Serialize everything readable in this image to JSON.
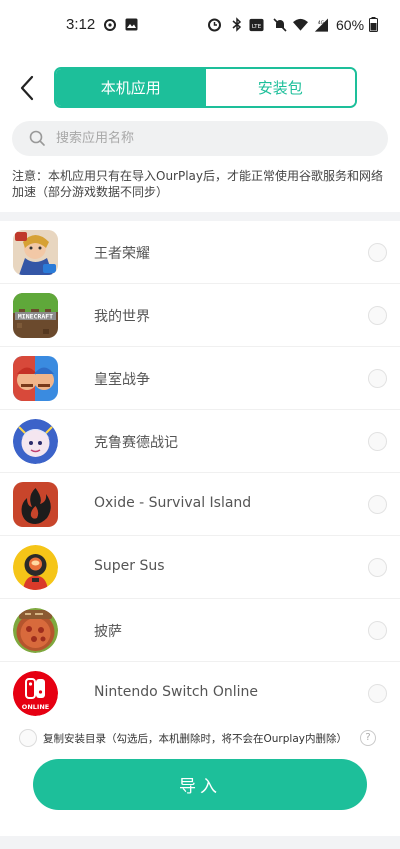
{
  "status_bar": {
    "time": "3:12",
    "battery": "60%",
    "icons": [
      "refresh-icon",
      "image-icon",
      "alarm-icon",
      "bluetooth-icon",
      "volte-icon",
      "mute-icon",
      "wifi-icon",
      "signal-4g-icon",
      "battery-icon"
    ]
  },
  "header": {
    "tabs": [
      {
        "label": "本机应用",
        "active": true
      },
      {
        "label": "安装包",
        "active": false
      }
    ]
  },
  "search": {
    "placeholder": "搜索应用名称",
    "value": ""
  },
  "notice": "注意：本机应用只有在导入OurPlay后，才能正常使用谷歌服务和网络加速（部分游戏数据不同步）",
  "apps": [
    {
      "name": "王者荣耀",
      "icon": "honor-of-kings-icon",
      "selected": false
    },
    {
      "name": "我的世界",
      "icon": "minecraft-icon",
      "selected": false
    },
    {
      "name": "皇室战争",
      "icon": "clash-royale-icon",
      "selected": false
    },
    {
      "name": "克鲁赛德战记",
      "icon": "crusaders-quest-icon",
      "selected": false
    },
    {
      "name": "Oxide - Survival Island",
      "icon": "oxide-icon",
      "selected": false
    },
    {
      "name": "Super Sus",
      "icon": "super-sus-icon",
      "selected": false
    },
    {
      "name": "披萨",
      "icon": "pizza-icon",
      "selected": false
    },
    {
      "name": "Nintendo Switch Online",
      "icon": "nintendo-switch-online-icon",
      "selected": false
    }
  ],
  "copy_option": {
    "label": "复制安装目录（勾选后，本机删除时，将不会在Ourplay内删除）",
    "checked": false,
    "help": "?"
  },
  "import_button": "导入",
  "colors": {
    "accent": "#1dbf9a"
  }
}
